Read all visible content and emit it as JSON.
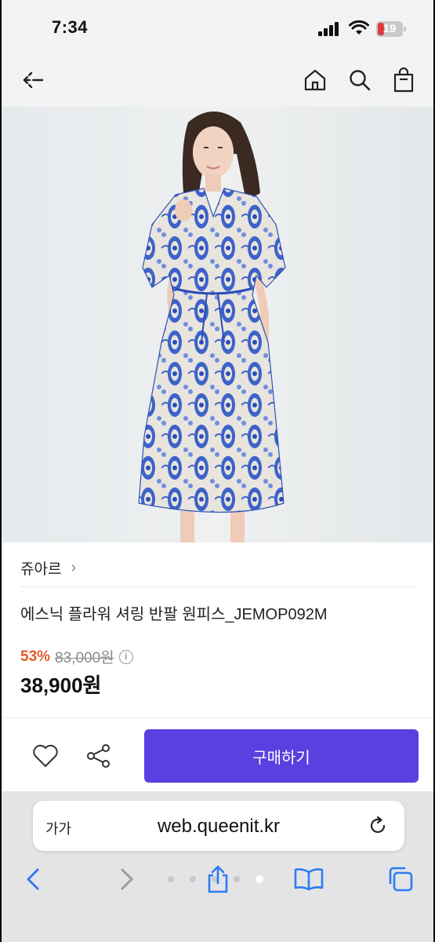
{
  "status_bar": {
    "time": "7:34",
    "battery_level": "19",
    "battery_color": "#e0393b"
  },
  "top_nav": {
    "back_icon": "back-arrow-icon",
    "home_icon": "home-icon",
    "search_icon": "search-icon",
    "cart_icon": "shopping-bag-icon"
  },
  "product": {
    "image_count": 5,
    "active_image_index": 4,
    "brand": "쥬아르",
    "title": "에스닉 플라워 셔링 반팔 원피스_JEMOP092M",
    "discount_rate": "53%",
    "original_price": "83,000원",
    "sale_price": "38,900원",
    "discount_color": "#e35a2a"
  },
  "actions": {
    "like_icon": "heart-icon",
    "share_icon": "share-icon",
    "buy_label": "구매하기",
    "accent_color": "#5b3fe0"
  },
  "safari": {
    "text_size_label": "가가",
    "url": "web.queenit.kr",
    "reload_icon": "reload-icon",
    "toolbar": [
      "back-icon",
      "forward-icon",
      "share-icon",
      "bookmarks-icon",
      "tabs-icon"
    ]
  }
}
